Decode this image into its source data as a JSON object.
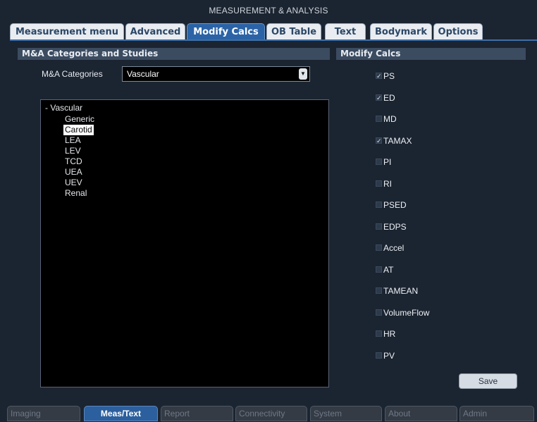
{
  "window": {
    "title": "MEASUREMENT & ANALYSIS"
  },
  "tabs": [
    {
      "label": "Measurement menu",
      "active": false
    },
    {
      "label": "Advanced",
      "active": false
    },
    {
      "label": "Modify Calcs",
      "active": true
    },
    {
      "label": "OB Table",
      "active": false
    },
    {
      "label": "Text",
      "active": false
    },
    {
      "label": "Bodymark",
      "active": false
    },
    {
      "label": "Options",
      "active": false
    }
  ],
  "left_panel": {
    "header": "M&A Categories and Studies",
    "category_label": "M&A Categories",
    "category_value": "Vascular",
    "tree_root": "- Vascular",
    "studies": [
      "Generic",
      "Carotid",
      "LEA",
      "LEV",
      "TCD",
      "UEA",
      "UEV",
      "Renal"
    ],
    "selected_study": "Carotid"
  },
  "right_panel": {
    "header": "Modify Calcs",
    "calcs": [
      {
        "label": "PS",
        "checked": true
      },
      {
        "label": "ED",
        "checked": true
      },
      {
        "label": "MD",
        "checked": false
      },
      {
        "label": "TAMAX",
        "checked": true
      },
      {
        "label": "PI",
        "checked": false
      },
      {
        "label": "RI",
        "checked": false
      },
      {
        "label": "PSED",
        "checked": false
      },
      {
        "label": "EDPS",
        "checked": false
      },
      {
        "label": "Accel",
        "checked": false
      },
      {
        "label": "AT",
        "checked": false
      },
      {
        "label": "TAMEAN",
        "checked": false
      },
      {
        "label": "VolumeFlow",
        "checked": false
      },
      {
        "label": "HR",
        "checked": false
      },
      {
        "label": "PV",
        "checked": false
      }
    ],
    "save_label": "Save"
  },
  "bottom_tabs": [
    {
      "label": "Imaging",
      "active": false
    },
    {
      "label": "Meas/Text",
      "active": true
    },
    {
      "label": "Report",
      "active": false
    },
    {
      "label": "Connectivity",
      "active": false
    },
    {
      "label": "System",
      "active": false
    },
    {
      "label": "About",
      "active": false
    },
    {
      "label": "Admin",
      "active": false
    }
  ],
  "colors": {
    "background": "#1b2431",
    "active_tab": "#2b63a6",
    "panel_header": "#3b4b60",
    "inactive_tab": "#e9edf2"
  }
}
